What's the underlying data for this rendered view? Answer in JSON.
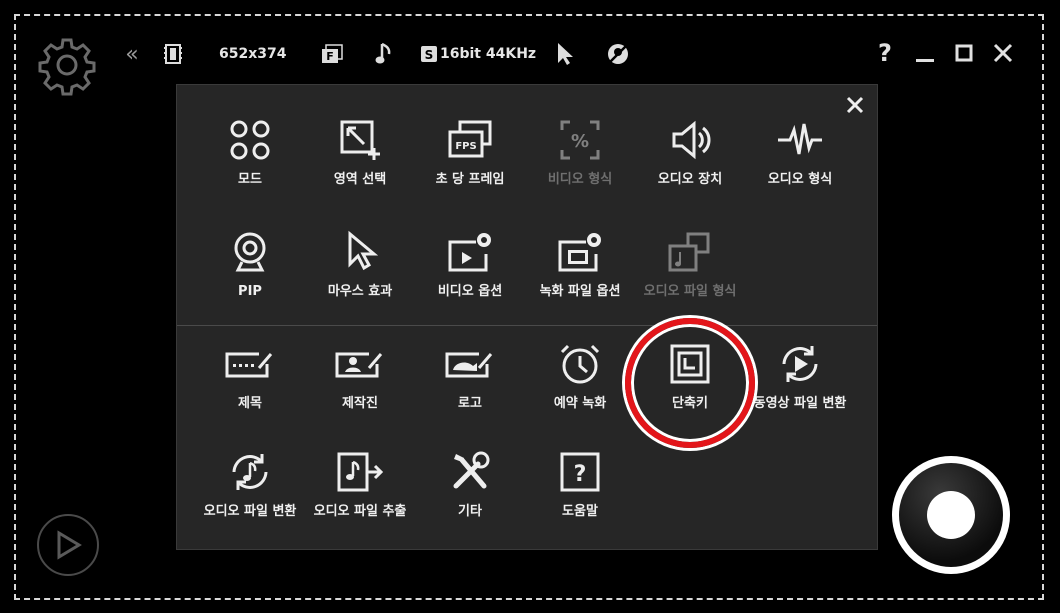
{
  "toolbar": {
    "resolution": "652x374",
    "audio_format": "16bit 44KHz",
    "icons": [
      "settings-gear-icon",
      "collapse-icon",
      "video-icon",
      "fps-icon",
      "audio-note-icon",
      "sound-icon",
      "cursor-icon",
      "webcam-off-icon"
    ],
    "window_controls": {
      "help": "?"
    }
  },
  "menu": {
    "top_items": [
      {
        "label": "모드",
        "icon": "mode-icon",
        "enabled": true
      },
      {
        "label": "영역 선택",
        "icon": "area-select-icon",
        "enabled": true
      },
      {
        "label": "초 당 프레임",
        "icon": "fps-icon",
        "enabled": true
      },
      {
        "label": "비디오 형식",
        "icon": "video-format-icon",
        "enabled": false
      },
      {
        "label": "오디오 장치",
        "icon": "audio-device-icon",
        "enabled": true
      },
      {
        "label": "오디오 형식",
        "icon": "audio-format-icon",
        "enabled": true
      },
      {
        "label": "PIP",
        "icon": "webcam-icon",
        "enabled": true
      },
      {
        "label": "마우스 효과",
        "icon": "cursor-icon",
        "enabled": true
      },
      {
        "label": "비디오 옵션",
        "icon": "video-options-icon",
        "enabled": true
      },
      {
        "label": "녹화 파일 옵션",
        "icon": "record-file-options-icon",
        "enabled": true
      },
      {
        "label": "오디오 파일 형식",
        "icon": "audio-file-format-icon",
        "enabled": false
      }
    ],
    "bottom_items": [
      {
        "label": "제목",
        "icon": "title-icon"
      },
      {
        "label": "제작진",
        "icon": "credits-icon"
      },
      {
        "label": "로고",
        "icon": "logo-icon"
      },
      {
        "label": "예약 녹화",
        "icon": "clock-icon"
      },
      {
        "label": "단축키",
        "icon": "hotkey-icon"
      },
      {
        "label": "동영상 파일 변환",
        "icon": "video-convert-icon"
      },
      {
        "label": "오디오 파일 변환",
        "icon": "audio-convert-icon"
      },
      {
        "label": "오디오 파일 추출",
        "icon": "audio-extract-icon"
      },
      {
        "label": "기타",
        "icon": "tools-icon"
      },
      {
        "label": "도움말",
        "icon": "help-icon"
      }
    ],
    "highlighted_item": "단축키"
  },
  "colors": {
    "background": "#000000",
    "panel": "#262626",
    "highlight_ring": "#e3161b",
    "disabled_text": "#6f6f6f"
  }
}
